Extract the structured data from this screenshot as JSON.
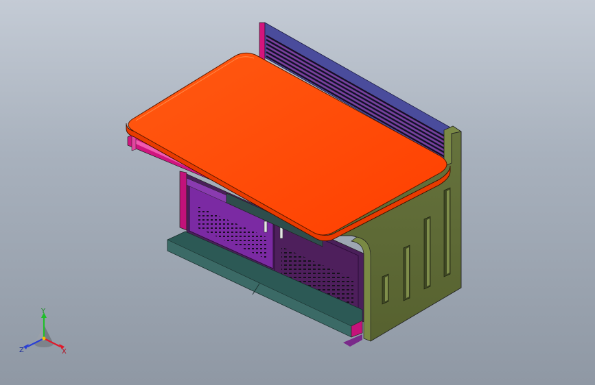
{
  "viewport": {
    "background_top": "#c4cbd5",
    "background_bottom": "#8f98a4"
  },
  "model": {
    "parts": [
      {
        "name": "desktop",
        "color": "#ff4500"
      },
      {
        "name": "back-panel",
        "color": "#4b4a99"
      },
      {
        "name": "side-panel",
        "color": "#5f6b39"
      },
      {
        "name": "cabinet-front",
        "color": "#7a2a9c"
      },
      {
        "name": "base-step",
        "color": "#2d5a56"
      },
      {
        "name": "trim",
        "color": "#e0117f"
      }
    ]
  },
  "triad": {
    "y_label": "Y",
    "z_label": "Z",
    "x_label": "X",
    "y_color": "#1fbf2a",
    "z_color": "#2a3fd6",
    "x_color": "#e0192a"
  }
}
